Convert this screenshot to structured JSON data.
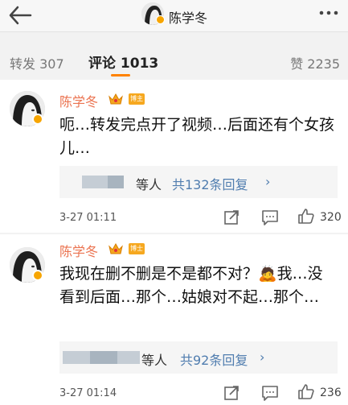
{
  "header": {
    "title": "陈学冬"
  },
  "tabs": {
    "repost": "转发 307",
    "comments": "评论 1013",
    "likes": "赞 2235"
  },
  "colors": {
    "accent": "#ff8200",
    "username": "#eb7350",
    "link": "#507daf",
    "badge": "#f6a81f"
  },
  "comments": [
    {
      "user": "陈学冬",
      "badge": "博主",
      "text": "呃…转发完点开了视频…后面还有个女孩儿…",
      "reply_people": "等人",
      "reply_count": "共132条回复",
      "reply_chevron": "›",
      "time": "3-27 01:11",
      "likes": "320"
    },
    {
      "user": "陈学冬",
      "badge": "博士",
      "text": "我现在删不删是不是都不对？🙇我…没看到后面…那个…姑娘对不起…那个…",
      "reply_people": "等人",
      "reply_count": "共92条回复",
      "reply_chevron": "›",
      "time": "3-27 01:14",
      "likes": "236"
    }
  ]
}
